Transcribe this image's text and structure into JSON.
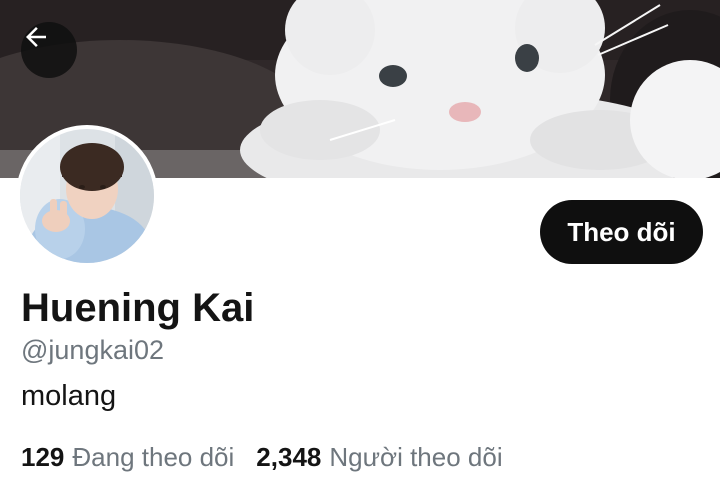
{
  "profile": {
    "display_name": "Huening Kai",
    "username": "@jungkai02",
    "bio": "molang",
    "follow_button_label": "Theo dõi",
    "following_count": "129",
    "following_label": "Đang theo dõi",
    "followers_count": "2,348",
    "followers_label": "Người theo dõi"
  },
  "icons": {
    "back": "arrow-left-icon"
  },
  "colors": {
    "follow_button_bg": "#0f0f0f",
    "follow_button_text": "#ffffff",
    "primary_text": "#141414",
    "secondary_text": "#6e767d",
    "background": "#ffffff"
  }
}
